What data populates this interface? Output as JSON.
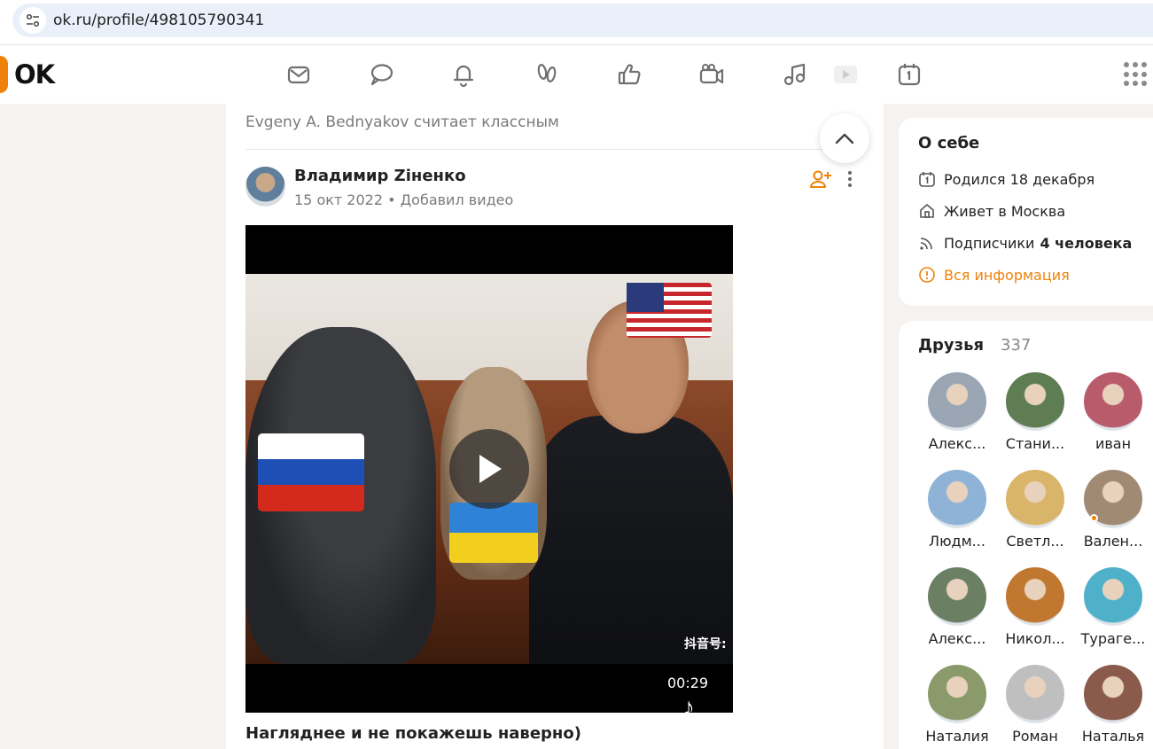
{
  "browser": {
    "url": "ok.ru/profile/498105790341"
  },
  "header": {
    "logo_text": "OK",
    "brand_color": "#ee8208",
    "nav_icons": [
      "messages-icon",
      "discussions-icon",
      "notifications-icon",
      "guests-icon",
      "reactions-icon",
      "video-call-icon",
      "music-icon",
      "video-icon",
      "events-icon"
    ],
    "apps_icon": "apps-grid-icon"
  },
  "feed": {
    "liked_text": "Evgeny A. Bednyakov считает классным",
    "post": {
      "author": "Владимир Ziненко",
      "date": "15 окт 2022",
      "separator": "•",
      "action": "Добавил видео",
      "video": {
        "duration": "00:29",
        "watermark": "抖音号:"
      },
      "caption": "Нагляднее и не покажешь наверно)"
    }
  },
  "about": {
    "title": "О себе",
    "birthday": "Родился 18 декабря",
    "lives": "Живет в Москва",
    "subscribers_label": "Подписчики",
    "subscribers_value": "4 человека",
    "all_info": "Вся информация"
  },
  "friends": {
    "title": "Друзья",
    "count": "337",
    "items": [
      {
        "name": "Алекс...",
        "color": "#9aa6b4"
      },
      {
        "name": "Стани...",
        "color": "#5f7d52"
      },
      {
        "name": "иван",
        "color": "#b85b6a"
      },
      {
        "name": "Людм...",
        "color": "#8fb3d6",
        "online": false
      },
      {
        "name": "Светл...",
        "color": "#d9b56a"
      },
      {
        "name": "Вален...",
        "color": "#a08a73",
        "online": true
      },
      {
        "name": "Алекс...",
        "color": "#6b7f62"
      },
      {
        "name": "Никол...",
        "color": "#c0772f"
      },
      {
        "name": "Турагe...",
        "color": "#4fb0c9"
      },
      {
        "name": "Наталия",
        "color": "#8a9a6a"
      },
      {
        "name": "Роман",
        "color": "#bfbfbf"
      },
      {
        "name": "Наталья",
        "color": "#8a5a4a"
      }
    ]
  }
}
